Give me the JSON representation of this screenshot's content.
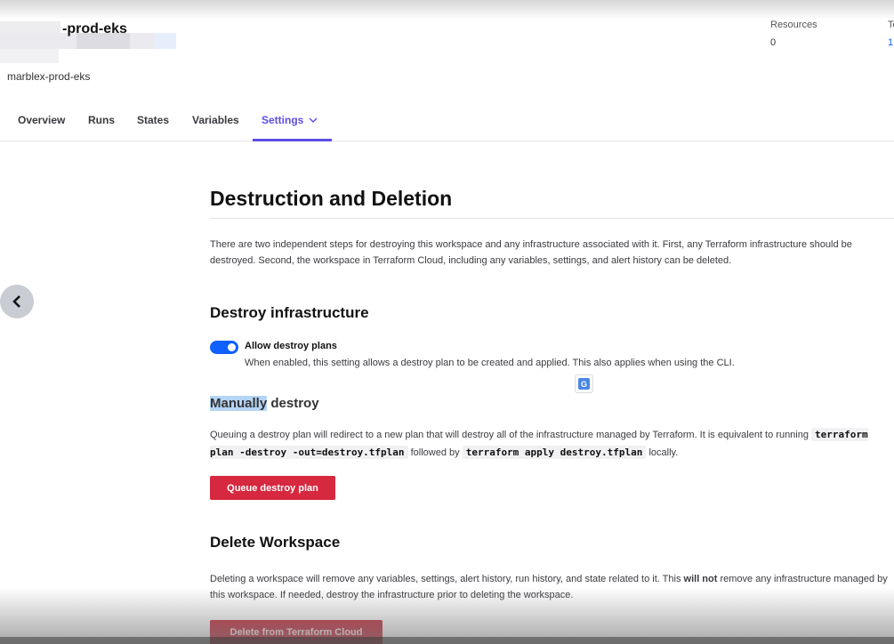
{
  "workspace": {
    "title": "-prod-eks",
    "subtitle": "marblex-prod-eks",
    "stats": {
      "resources_label": "Resources",
      "resources_value": "0",
      "second_label": "Te",
      "second_value": "1"
    }
  },
  "tabs": [
    {
      "label": "Overview"
    },
    {
      "label": "Runs"
    },
    {
      "label": "States"
    },
    {
      "label": "Variables"
    },
    {
      "label": "Settings",
      "active": true
    }
  ],
  "page": {
    "title": "Destruction and Deletion",
    "intro": "There are two independent steps for destroying this workspace and any infrastructure associated with it. First, any Terraform infrastructure should be destroyed. Second, the workspace in Terraform Cloud, including any variables, settings, and alert history can be deleted."
  },
  "destroy": {
    "heading": "Destroy infrastructure",
    "toggle_label": "Allow destroy plans",
    "toggle_on": true,
    "toggle_help": "When enabled, this setting allows a destroy plan to be created and applied. This also applies when using the CLI.",
    "manual_heading_highlight": "Manually",
    "manual_heading_rest": " destroy",
    "manual_text_1": "Queuing a destroy plan will redirect to a new plan that will destroy all of the infrastructure managed by Terraform. It is equivalent to running",
    "code_1": "terraform plan -destroy -out=destroy.tfplan",
    "manual_text_2": " followed by ",
    "code_2": "terraform apply destroy.tfplan",
    "manual_text_3": " locally.",
    "button_label": "Queue destroy plan"
  },
  "delete": {
    "heading": "Delete Workspace",
    "text_1": "Deleting a workspace will remove any variables, settings, alert history, run history, and state related to it. This ",
    "text_bold": "will not",
    "text_2": " remove any infrastructure managed by this workspace. If needed, destroy the infrastructure prior to deleting the workspace.",
    "button_label": "Delete from Terraform Cloud"
  },
  "colors": {
    "accent": "#5c4ee5",
    "toggle": "#1060ff",
    "danger": "#d6283e"
  },
  "icons": {
    "back": "chevron-left-icon",
    "tab_dropdown": "chevron-down-icon",
    "translate": "translate-icon"
  }
}
